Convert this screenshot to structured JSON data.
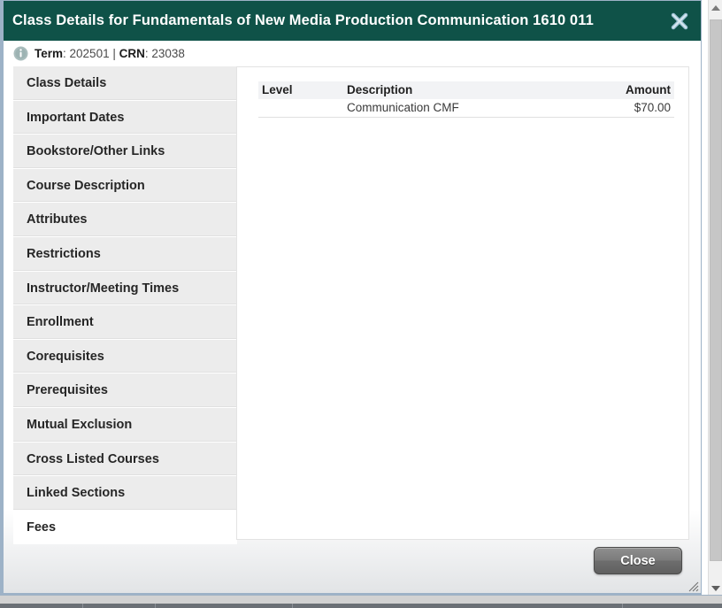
{
  "dialog": {
    "title": "Class Details for Fundamentals of New Media Production Communication 1610 011",
    "close_icon": "close-x-icon",
    "info": {
      "icon": "info-circle-icon",
      "term_label": "Term",
      "term_value": "202501",
      "separator": "|",
      "crn_label": "CRN",
      "crn_value": "23038"
    },
    "tabs": [
      {
        "label": "Class Details",
        "active": false
      },
      {
        "label": "Important Dates",
        "active": false
      },
      {
        "label": "Bookstore/Other Links",
        "active": false
      },
      {
        "label": "Course Description",
        "active": false
      },
      {
        "label": "Attributes",
        "active": false
      },
      {
        "label": "Restrictions",
        "active": false
      },
      {
        "label": "Instructor/Meeting Times",
        "active": false
      },
      {
        "label": "Enrollment",
        "active": false
      },
      {
        "label": "Corequisites",
        "active": false
      },
      {
        "label": "Prerequisites",
        "active": false
      },
      {
        "label": "Mutual Exclusion",
        "active": false
      },
      {
        "label": "Cross Listed Courses",
        "active": false
      },
      {
        "label": "Linked Sections",
        "active": false
      },
      {
        "label": "Fees",
        "active": true
      }
    ],
    "fees_table": {
      "columns": [
        "Level",
        "Description",
        "Amount"
      ],
      "rows": [
        {
          "level": "",
          "description": "Communication CMF",
          "amount": "$70.00"
        }
      ]
    },
    "footer": {
      "close_label": "Close",
      "resize_grip_icon": "resize-grip-icon"
    }
  },
  "browser": {
    "scrollbar": {
      "up_arrow_icon": "scroll-up-arrow-icon",
      "down_arrow_icon": "scroll-down-arrow-icon"
    }
  },
  "colors": {
    "title_bar": "#0f5248",
    "tab_inactive": "#ececec",
    "tab_active": "#ffffff",
    "dialog_border": "#9db2c7",
    "table_header_bg": "#f2f3f5"
  }
}
